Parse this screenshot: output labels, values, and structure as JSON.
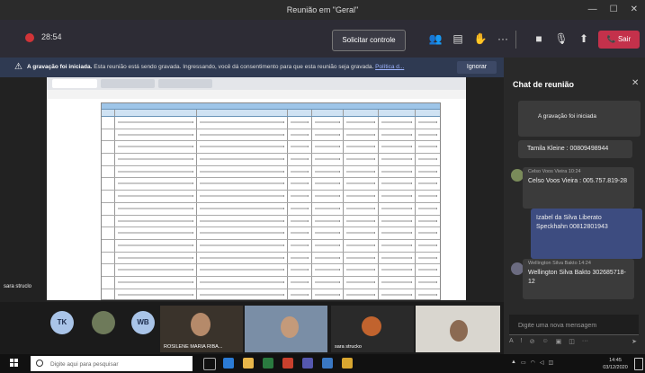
{
  "window": {
    "title": "Reunião em \"Geral\""
  },
  "toolbar": {
    "timer": "28:54",
    "request_control_label": "Solicitar controle",
    "leave_label": "Sair"
  },
  "recording_notice": {
    "title": "A gravação foi iniciada.",
    "message": "Esta reunião está sendo gravada. Ingressando, você dá consentimento para que esta reunião seja gravada.",
    "policy_link": "Política d...",
    "ignore_label": "Ignorar"
  },
  "shared_screen": {
    "presenter_label": "sara struclo"
  },
  "chat": {
    "header": "Chat de reunião",
    "messages": [
      {
        "text": "A gravação foi iniciada"
      },
      {
        "text": "Tamila Kleine : 00809498944"
      },
      {
        "meta": "Celso Voos Vieira   10:24",
        "text": "Celso Voos Vieira : 005.757.819-28"
      },
      {
        "text": "Izabel da Silva Liberato Speckhahn 00812801943"
      },
      {
        "meta": "Wellington Silva Bakto   14:24",
        "text": "Wellington Silva Bakto 302685718-12"
      }
    ],
    "input_placeholder": "Digite uma nova mensagem"
  },
  "participants": {
    "initials": [
      "TK",
      "WB"
    ],
    "video_labels": [
      "ROSILENE MARIA RIBA...",
      "",
      "sara strucko",
      ""
    ]
  },
  "taskbar": {
    "search_placeholder": "Digite aqui para pesquisar",
    "time": "14:45",
    "date": "03/12/2020"
  },
  "colors": {
    "accent_leave": "#c4314b",
    "recording": "#d13438",
    "notice_bg": "#2f3a52",
    "chat_self": "#3d4c80"
  }
}
